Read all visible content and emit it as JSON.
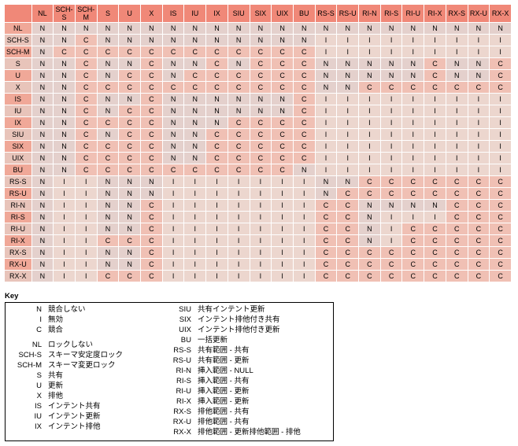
{
  "headers": [
    "",
    "NL",
    "SCH-S",
    "SCH-M",
    "S",
    "U",
    "X",
    "IS",
    "IU",
    "IX",
    "SIU",
    "SIX",
    "UIX",
    "BU",
    "RS-S",
    "RS-U",
    "RI-N",
    "RI-S",
    "RI-U",
    "RI-X",
    "RX-S",
    "RX-U",
    "RX-X"
  ],
  "rows": [
    {
      "label": "NL",
      "cells": [
        "N",
        "N",
        "N",
        "N",
        "N",
        "N",
        "N",
        "N",
        "N",
        "N",
        "N",
        "N",
        "N",
        "N",
        "N",
        "N",
        "N",
        "N",
        "N",
        "N",
        "N",
        "N"
      ]
    },
    {
      "label": "SCH-S",
      "cells": [
        "N",
        "N",
        "C",
        "N",
        "N",
        "N",
        "N",
        "N",
        "N",
        "N",
        "N",
        "N",
        "N",
        "I",
        "I",
        "I",
        "I",
        "I",
        "I",
        "I",
        "I",
        "I"
      ]
    },
    {
      "label": "SCH-M",
      "cells": [
        "N",
        "C",
        "C",
        "C",
        "C",
        "C",
        "C",
        "C",
        "C",
        "C",
        "C",
        "C",
        "C",
        "I",
        "I",
        "I",
        "I",
        "I",
        "I",
        "I",
        "I",
        "I"
      ]
    },
    {
      "label": "S",
      "cells": [
        "N",
        "N",
        "C",
        "N",
        "N",
        "C",
        "N",
        "N",
        "C",
        "N",
        "C",
        "C",
        "C",
        "N",
        "N",
        "N",
        "N",
        "N",
        "C",
        "N",
        "N",
        "C"
      ]
    },
    {
      "label": "U",
      "cells": [
        "N",
        "N",
        "C",
        "N",
        "C",
        "C",
        "N",
        "C",
        "C",
        "C",
        "C",
        "C",
        "C",
        "N",
        "N",
        "N",
        "N",
        "N",
        "C",
        "N",
        "N",
        "C"
      ]
    },
    {
      "label": "X",
      "cells": [
        "N",
        "N",
        "C",
        "C",
        "C",
        "C",
        "C",
        "C",
        "C",
        "C",
        "C",
        "C",
        "C",
        "N",
        "N",
        "C",
        "C",
        "C",
        "C",
        "C",
        "C",
        "C"
      ]
    },
    {
      "label": "IS",
      "cells": [
        "N",
        "N",
        "C",
        "N",
        "N",
        "C",
        "N",
        "N",
        "N",
        "N",
        "N",
        "N",
        "C",
        "I",
        "I",
        "I",
        "I",
        "I",
        "I",
        "I",
        "I",
        "I"
      ]
    },
    {
      "label": "IU",
      "cells": [
        "N",
        "N",
        "C",
        "N",
        "C",
        "C",
        "N",
        "N",
        "N",
        "N",
        "N",
        "N",
        "C",
        "I",
        "I",
        "I",
        "I",
        "I",
        "I",
        "I",
        "I",
        "I"
      ]
    },
    {
      "label": "IX",
      "cells": [
        "N",
        "N",
        "C",
        "C",
        "C",
        "C",
        "N",
        "N",
        "N",
        "C",
        "C",
        "C",
        "C",
        "I",
        "I",
        "I",
        "I",
        "I",
        "I",
        "I",
        "I",
        "I"
      ]
    },
    {
      "label": "SIU",
      "cells": [
        "N",
        "N",
        "C",
        "N",
        "C",
        "C",
        "N",
        "N",
        "C",
        "C",
        "C",
        "C",
        "C",
        "I",
        "I",
        "I",
        "I",
        "I",
        "I",
        "I",
        "I",
        "I"
      ]
    },
    {
      "label": "SIX",
      "cells": [
        "N",
        "N",
        "C",
        "C",
        "C",
        "C",
        "N",
        "N",
        "C",
        "C",
        "C",
        "C",
        "C",
        "I",
        "I",
        "I",
        "I",
        "I",
        "I",
        "I",
        "I",
        "I"
      ]
    },
    {
      "label": "UIX",
      "cells": [
        "N",
        "N",
        "C",
        "C",
        "C",
        "C",
        "N",
        "N",
        "C",
        "C",
        "C",
        "C",
        "C",
        "I",
        "I",
        "I",
        "I",
        "I",
        "I",
        "I",
        "I",
        "I"
      ]
    },
    {
      "label": "BU",
      "cells": [
        "N",
        "N",
        "C",
        "C",
        "C",
        "C",
        "C",
        "C",
        "C",
        "C",
        "C",
        "C",
        "N",
        "I",
        "I",
        "I",
        "I",
        "I",
        "I",
        "I",
        "I",
        "I"
      ]
    },
    {
      "label": "RS-S",
      "cells": [
        "N",
        "I",
        "I",
        "N",
        "N",
        "N",
        "I",
        "I",
        "I",
        "I",
        "I",
        "I",
        "I",
        "N",
        "N",
        "C",
        "C",
        "C",
        "C",
        "C",
        "C",
        "C"
      ]
    },
    {
      "label": "RS-U",
      "cells": [
        "N",
        "I",
        "I",
        "N",
        "N",
        "N",
        "I",
        "I",
        "I",
        "I",
        "I",
        "I",
        "I",
        "N",
        "C",
        "C",
        "C",
        "C",
        "C",
        "C",
        "C",
        "C"
      ]
    },
    {
      "label": "RI-N",
      "cells": [
        "N",
        "I",
        "I",
        "N",
        "N",
        "C",
        "I",
        "I",
        "I",
        "I",
        "I",
        "I",
        "I",
        "C",
        "C",
        "N",
        "N",
        "N",
        "N",
        "C",
        "C",
        "C"
      ]
    },
    {
      "label": "RI-S",
      "cells": [
        "N",
        "I",
        "I",
        "N",
        "N",
        "C",
        "I",
        "I",
        "I",
        "I",
        "I",
        "I",
        "I",
        "C",
        "C",
        "N",
        "I",
        "I",
        "I",
        "C",
        "C",
        "C"
      ]
    },
    {
      "label": "RI-U",
      "cells": [
        "N",
        "I",
        "I",
        "N",
        "N",
        "C",
        "I",
        "I",
        "I",
        "I",
        "I",
        "I",
        "I",
        "C",
        "C",
        "N",
        "I",
        "C",
        "C",
        "C",
        "C",
        "C"
      ]
    },
    {
      "label": "RI-X",
      "cells": [
        "N",
        "I",
        "I",
        "C",
        "C",
        "C",
        "I",
        "I",
        "I",
        "I",
        "I",
        "I",
        "I",
        "C",
        "C",
        "N",
        "I",
        "C",
        "C",
        "C",
        "C",
        "C"
      ]
    },
    {
      "label": "RX-S",
      "cells": [
        "N",
        "I",
        "I",
        "N",
        "N",
        "C",
        "I",
        "I",
        "I",
        "I",
        "I",
        "I",
        "I",
        "C",
        "C",
        "C",
        "C",
        "C",
        "C",
        "C",
        "C",
        "C"
      ]
    },
    {
      "label": "RX-U",
      "cells": [
        "N",
        "I",
        "I",
        "N",
        "N",
        "C",
        "I",
        "I",
        "I",
        "I",
        "I",
        "I",
        "I",
        "C",
        "C",
        "C",
        "C",
        "C",
        "C",
        "C",
        "C",
        "C"
      ]
    },
    {
      "label": "RX-X",
      "cells": [
        "N",
        "I",
        "I",
        "C",
        "C",
        "C",
        "I",
        "I",
        "I",
        "I",
        "I",
        "I",
        "I",
        "C",
        "C",
        "C",
        "C",
        "C",
        "C",
        "C",
        "C",
        "C"
      ]
    }
  ],
  "key_title": "Key",
  "key_col1": [
    {
      "code": "N",
      "desc": "競合しない"
    },
    {
      "code": "I",
      "desc": "無効"
    },
    {
      "code": "C",
      "desc": "競合"
    },
    {
      "spacer": true
    },
    {
      "code": "NL",
      "desc": "ロックしない"
    },
    {
      "code": "SCH-S",
      "desc": "スキーマ安定度ロック"
    },
    {
      "code": "SCH-M",
      "desc": "スキーマ変更ロック"
    },
    {
      "code": "S",
      "desc": "共有"
    },
    {
      "code": "U",
      "desc": "更新"
    },
    {
      "code": "X",
      "desc": "排他"
    },
    {
      "code": "IS",
      "desc": "インテント共有"
    },
    {
      "code": "IU",
      "desc": "インテント更新"
    },
    {
      "code": "IX",
      "desc": "インテント排他"
    }
  ],
  "key_col2": [
    {
      "code": "SIU",
      "desc": "共有インテント更新"
    },
    {
      "code": "SIX",
      "desc": "インテント排他付き共有"
    },
    {
      "code": "UIX",
      "desc": "インテント排他付き更新"
    },
    {
      "code": "BU",
      "desc": "一括更新"
    },
    {
      "code": "RS-S",
      "desc": "共有範囲 - 共有"
    },
    {
      "code": "RS-U",
      "desc": "共有範囲 - 更新"
    },
    {
      "code": "RI-N",
      "desc": "挿入範囲 - NULL"
    },
    {
      "code": "RI-S",
      "desc": "挿入範囲 - 共有"
    },
    {
      "code": "RI-U",
      "desc": "挿入範囲 - 更新"
    },
    {
      "code": "RI-X",
      "desc": "挿入範囲 - 更新"
    },
    {
      "code": "RX-S",
      "desc": "排他範囲 - 共有"
    },
    {
      "code": "RX-U",
      "desc": "排他範囲 - 共有"
    },
    {
      "code": "RX-X",
      "desc": "排他範囲 - 更新排他範囲 - 排他"
    }
  ]
}
